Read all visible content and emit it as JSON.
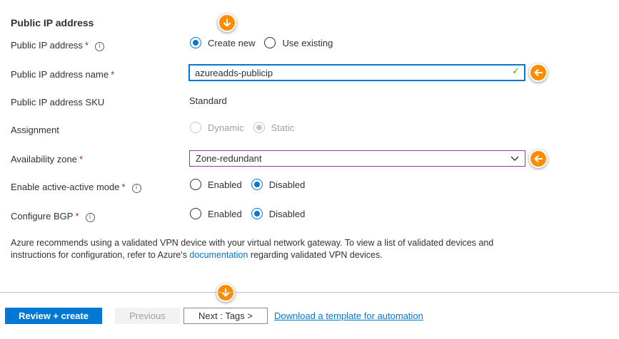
{
  "section_title": "Public IP address",
  "fields": {
    "public_ip": {
      "label": "Public IP address",
      "required": "*",
      "info": "i",
      "options": [
        "Create new",
        "Use existing"
      ],
      "selected": "Create new"
    },
    "public_ip_name": {
      "label": "Public IP address name",
      "required": "*",
      "value": "azureadds-publicip"
    },
    "sku": {
      "label": "Public IP address SKU",
      "value": "Standard"
    },
    "assignment": {
      "label": "Assignment",
      "options": [
        "Dynamic",
        "Static"
      ],
      "selected": "Static",
      "disabled": true
    },
    "availability_zone": {
      "label": "Availability zone",
      "required": "*",
      "value": "Zone-redundant"
    },
    "active_active": {
      "label": "Enable active-active mode",
      "required": "*",
      "info": "i",
      "options": [
        "Enabled",
        "Disabled"
      ],
      "selected": "Disabled"
    },
    "bgp": {
      "label": "Configure BGP",
      "required": "*",
      "info": "i",
      "options": [
        "Enabled",
        "Disabled"
      ],
      "selected": "Disabled"
    }
  },
  "note": {
    "before": "Azure recommends using a validated VPN device with your virtual network gateway. To view a list of validated devices and instructions for configuration, refer to Azure's ",
    "link": "documentation",
    "after": " regarding validated VPN devices."
  },
  "footer": {
    "review_create": "Review + create",
    "previous": "Previous",
    "next": "Next : Tags >",
    "download_link": "Download a template for automation"
  },
  "colors": {
    "accent": "#0078d4",
    "callout": "#ff8c00",
    "valid": "#57a300",
    "required": "#a4262c"
  },
  "icons": {
    "callout_down": "arrow-down-icon",
    "callout_left": "arrow-left-icon",
    "valid": "checkmark-icon",
    "dropdown": "chevron-down-icon",
    "info": "info-icon"
  }
}
